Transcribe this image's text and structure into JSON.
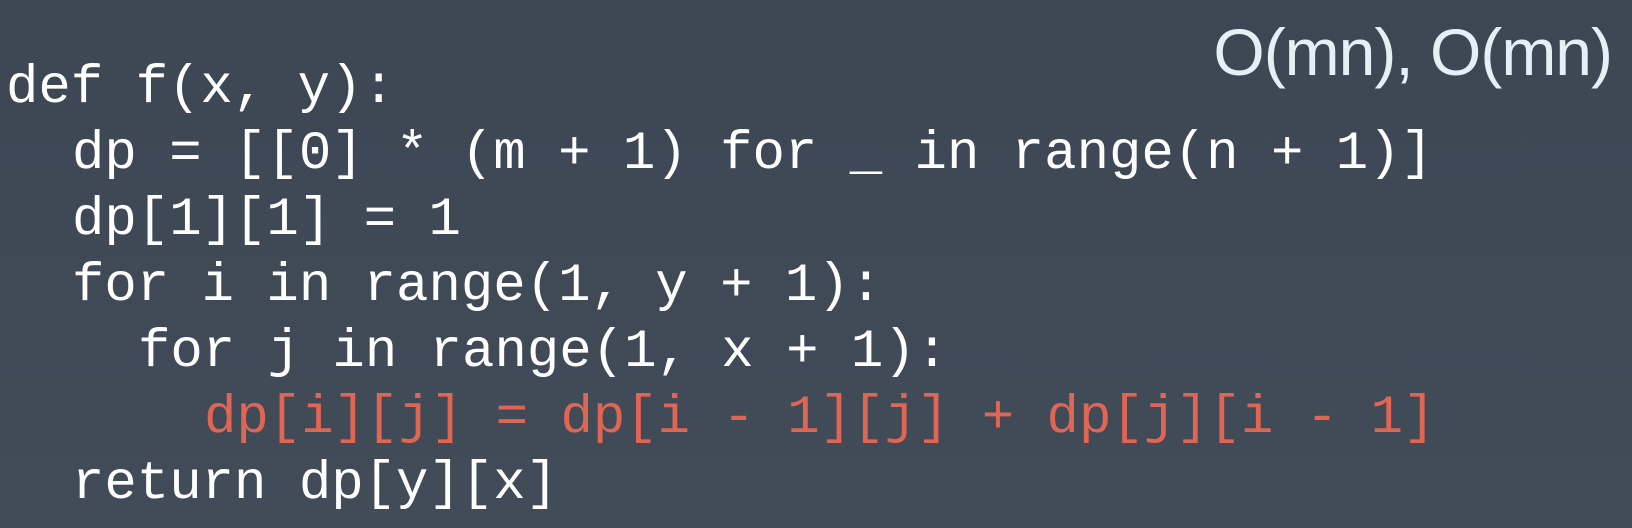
{
  "complexity_label": "O(mn), O(mn)",
  "code_lines": [
    {
      "text": "def f(x, y):",
      "highlighted": false
    },
    {
      "text": "dp = [[0] * (m + 1) for _ in range(n + 1)]",
      "highlighted": false
    },
    {
      "text": "dp[1][1] = 1",
      "highlighted": false
    },
    {
      "text": "for i in range(1, y + 1):",
      "highlighted": false
    },
    {
      "text": "for j in range(1, x + 1):",
      "highlighted": false
    },
    {
      "text": "dp[i][j] = dp[i - 1][j] + dp[j][i - 1]",
      "highlighted": true
    },
    {
      "text": "return dp[y][x]",
      "highlighted": false
    }
  ],
  "colors": {
    "background": "#3f4956",
    "code_text": "#ffffff",
    "highlight_text": "#e06654",
    "complexity_text": "#e3f1f7"
  }
}
